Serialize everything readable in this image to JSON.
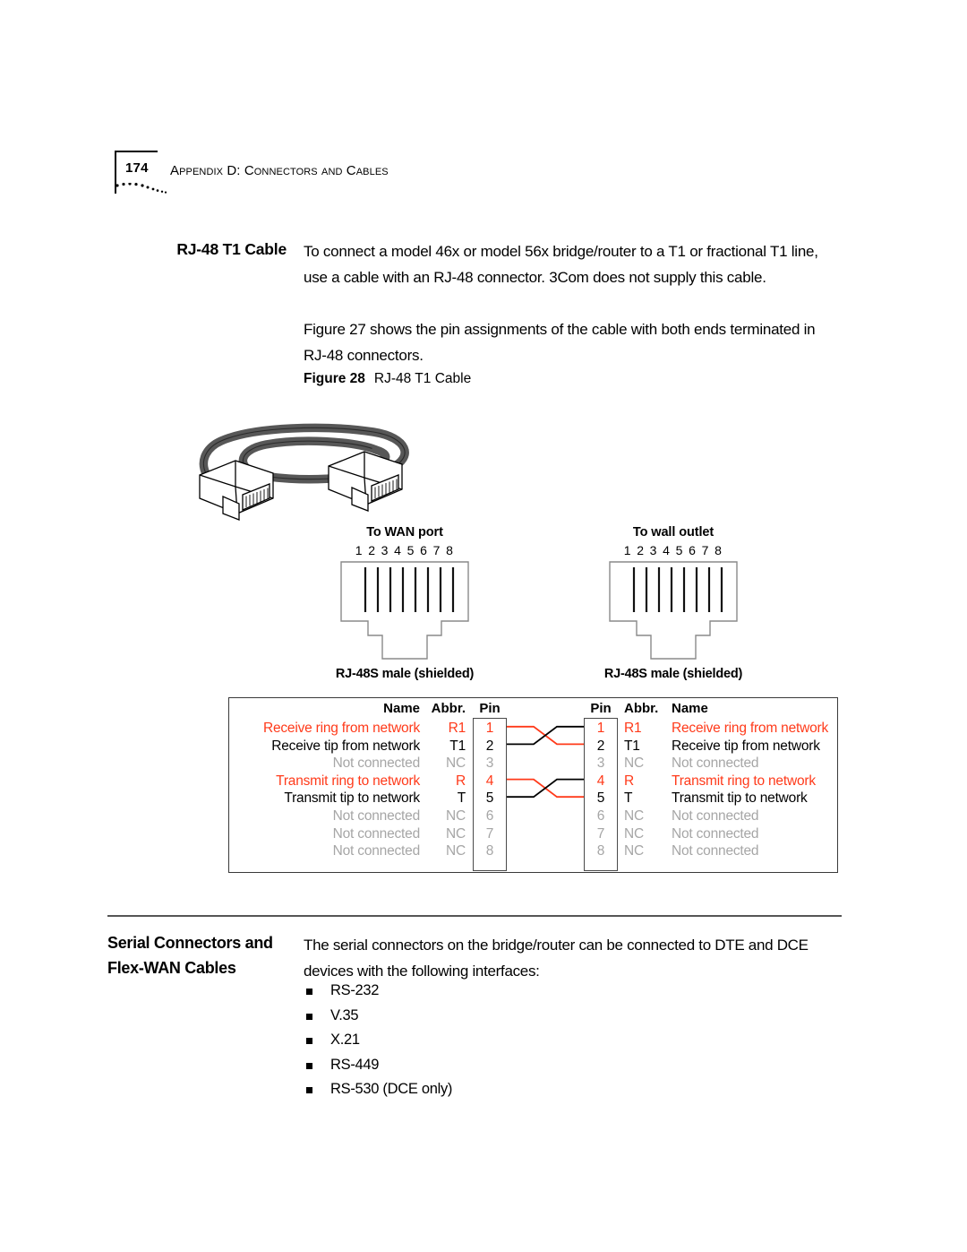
{
  "header": {
    "page_number": "174",
    "title": "Appendix D: Connectors and Cables"
  },
  "rj48_section": {
    "heading": "RJ-48 T1 Cable",
    "paragraph_1": "To connect a model 46x or model 56x bridge/router to a T1 or fractional T1 line, use a cable with an RJ-48 connector. 3Com does not supply this cable.",
    "paragraph_2": "Figure 27 shows the pin assignments of the cable with both ends terminated in RJ-48 connectors."
  },
  "figure": {
    "label": "Figure 28",
    "title": "RJ-48 T1 Cable"
  },
  "connectors": [
    {
      "title": "To WAN port",
      "pin_numbers": "1 2 3 4 5 6 7 8",
      "caption": "RJ-48S male (shielded)"
    },
    {
      "title": "To wall outlet",
      "pin_numbers": "1 2 3 4 5 6 7 8",
      "caption": "RJ-48S male (shielded)"
    }
  ],
  "pin_table": {
    "headers": {
      "name": "Name",
      "abbr": "Abbr.",
      "pin": "Pin",
      "pin_right": "Pin",
      "abbr_right": "Abbr.",
      "name_right": "Name"
    },
    "rows": [
      {
        "pin": "1",
        "abbr": "R1",
        "name": "Receive ring from network",
        "color": "#ff3a1a",
        "state": "red"
      },
      {
        "pin": "2",
        "abbr": "T1",
        "name": "Receive tip from network",
        "color": "#000000",
        "state": "black"
      },
      {
        "pin": "3",
        "abbr": "NC",
        "name": "Not connected",
        "color": "#a6a6a6",
        "state": "gray"
      },
      {
        "pin": "4",
        "abbr": "R",
        "name": "Transmit ring to network",
        "color": "#ff3a1a",
        "state": "red"
      },
      {
        "pin": "5",
        "abbr": "T",
        "name": "Transmit tip to network",
        "color": "#000000",
        "state": "black"
      },
      {
        "pin": "6",
        "abbr": "NC",
        "name": "Not connected",
        "color": "#a6a6a6",
        "state": "gray"
      },
      {
        "pin": "7",
        "abbr": "NC",
        "name": "Not connected",
        "color": "#a6a6a6",
        "state": "gray"
      },
      {
        "pin": "8",
        "abbr": "NC",
        "name": "Not connected",
        "color": "#a6a6a6",
        "state": "gray"
      }
    ],
    "wiring": [
      {
        "from_pin": "1",
        "to_pin": "2",
        "color": "#ff3a1a"
      },
      {
        "from_pin": "2",
        "to_pin": "1",
        "color": "#000000"
      },
      {
        "from_pin": "4",
        "to_pin": "5",
        "color": "#ff3a1a"
      },
      {
        "from_pin": "5",
        "to_pin": "4",
        "color": "#000000"
      }
    ]
  },
  "serial_section": {
    "heading": "Serial Connectors and Flex-WAN Cables",
    "paragraph": "The serial connectors on the bridge/router can be connected to DTE and DCE devices with the following interfaces:",
    "interfaces": [
      "RS-232",
      "V.35",
      "X.21",
      "RS-449",
      "RS-530 (DCE only)"
    ]
  }
}
